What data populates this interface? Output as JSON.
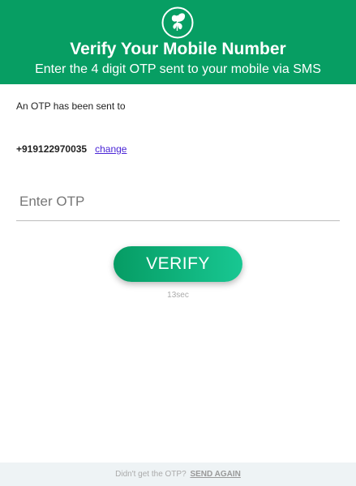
{
  "header": {
    "title": "Verify Your Mobile Number",
    "subtitle": "Enter the 4 digit OTP sent to your mobile via SMS",
    "logo_icon": "butterfly-icon",
    "background_color": "#079e63"
  },
  "main": {
    "sent_to_text": "An OTP has been sent to",
    "phone_number": "+919122970035",
    "change_label": "change",
    "otp_placeholder": "Enter OTP",
    "otp_value": "",
    "verify_label": "VERIFY",
    "timer_text": "13sec"
  },
  "footer": {
    "prompt_text": "Didn't get the OTP?",
    "send_again_label": "SEND AGAIN"
  },
  "colors": {
    "accent": "#079e63",
    "button_gradient_end": "#18c792",
    "link": "#4a25d6"
  }
}
